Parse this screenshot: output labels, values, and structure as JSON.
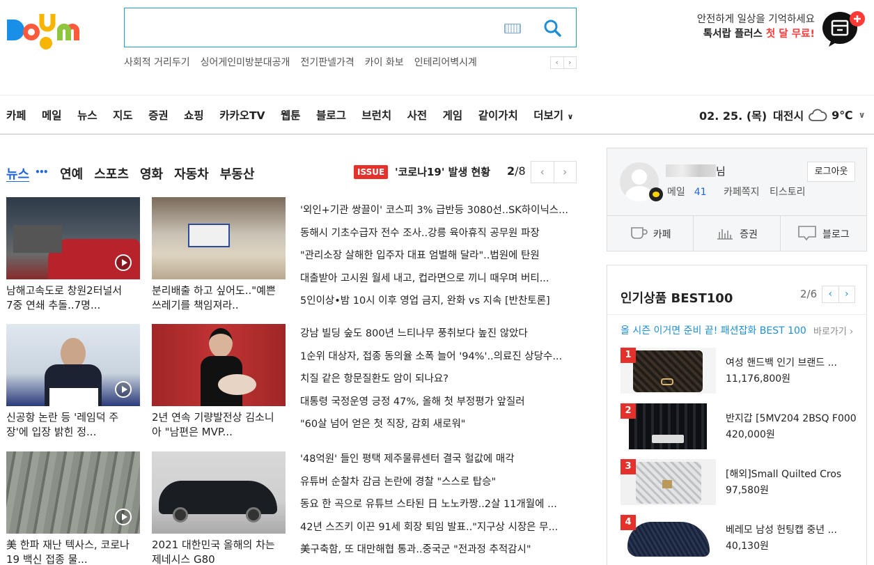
{
  "logo": {
    "text": "Daum"
  },
  "search": {
    "placeholder": ""
  },
  "keywords": [
    "사회적 거리두기",
    "싱어게인미방분대공개",
    "전기판넬가격",
    "카이 화보",
    "인테리어벽시계"
  ],
  "promo": {
    "line1": "안전하게 일상을 기억하세요",
    "line2_a": "톡서랍 플러스 ",
    "line2_b": "첫 달 무료!"
  },
  "gnb": [
    "카페",
    "메일",
    "뉴스",
    "지도",
    "증권",
    "쇼핑",
    "카카오TV",
    "웹툰",
    "블로그",
    "브런치",
    "사전",
    "게임",
    "같이가치",
    "더보기"
  ],
  "date": "02. 25. (목)",
  "weather": {
    "city": "대전시",
    "temp": "9℃"
  },
  "tabs": [
    "뉴스",
    "연예",
    "스포츠",
    "영화",
    "자동차",
    "부동산"
  ],
  "issue": {
    "badge": "ISSUE",
    "title": "'코로나19' 발생 현황",
    "page": "2",
    "total": "/8"
  },
  "photos": [
    {
      "caption": "남해고속도로 창원2터널서 7중 연쇄 추돌..7명..."
    },
    {
      "caption": "분리배출 하고 싶어도..\"예쁜 쓰레기를 책임져라.."
    },
    {
      "caption": "신공항 논란 등 '레임덕 주장'에 입장 밝힌 정..."
    },
    {
      "caption": "2년 연속 기량발전상 김소니아 \"남편은 MVP..."
    },
    {
      "caption": "美 한파 재난 텍사스, 코로나19 백신 접종 물..."
    },
    {
      "caption": "2021 대한민국 올해의 차는 제네시스 G80"
    }
  ],
  "headlines": [
    [
      "'외인+기관 쌍끌이' 코스피 3% 급반등 3080선..SK하이닉스...",
      "동해시 기초수급자 전수 조사..강릉 육아휴직 공무원 파장",
      "\"관리소장 살해한 입주자 대표 엄벌해 달라\"..법원에 탄원",
      "대출받아 고시원 월세 내고, 컵라면으로 끼니 때우며 버티...",
      "5인이상•밤 10시 이후 영업 금지, 완화 vs 지속 [반찬토론]"
    ],
    [
      "강남 빌딩 숲도 800년 느티나무 풍취보다 높진 않았다",
      "1순위 대상자, 접종 동의율 소폭 늘어 '94%'..의료진 상당수...",
      "치질 같은 항문질환도 암이 되나요?",
      "대통령 국정운영 긍정 47%, 올해 첫 부정평가 앞질러",
      "\"60살 넘어 얻은 첫 직장, 감회 새로워\""
    ],
    [
      "'48억원' 들인 평택 제주물류센터 결국 헐값에 매각",
      "유튜버 순찰차 감금 논란에 경찰 \"스스로 탑승\"",
      "동요 한 곡으로 유튜브 스타된 日 노노카짱..2살 11개월에 ...",
      "42년 스즈키 이끈 91세 회장 퇴임 발표..\"지구상 시장은 무...",
      "美구축함, 또 대만해협 통과..중국군 \"전과정 추적감시\""
    ]
  ],
  "login": {
    "suffix": "님",
    "logout": "로그아웃",
    "mail": "메일",
    "mail_count": "41",
    "cafe_note": "카페쪽지",
    "tistory": "티스토리",
    "svc": [
      "카페",
      "증권",
      "블로그"
    ],
    "svc_icons": [
      "cup-icon",
      "chart-icon",
      "blog-icon"
    ]
  },
  "best": {
    "title": "인기상품 BEST100",
    "page": "2/6",
    "sub": "올 시즌 이거면 준비 끝! 패션잡화 BEST 100",
    "go": "바로가기 ›",
    "items": [
      {
        "rank": "1",
        "name": "여성 핸드백 인기 브랜드 ...",
        "price": "11,176,800원"
      },
      {
        "rank": "2",
        "name": "반지갑 [5MV204 2BSQ F000",
        "price": "420,000원"
      },
      {
        "rank": "3",
        "name": "[해외]Small Quilted Cros",
        "price": "97,580원"
      },
      {
        "rank": "4",
        "name": "베레모 남성 헌팅캡 중년 ...",
        "price": "40,130원"
      }
    ]
  }
}
